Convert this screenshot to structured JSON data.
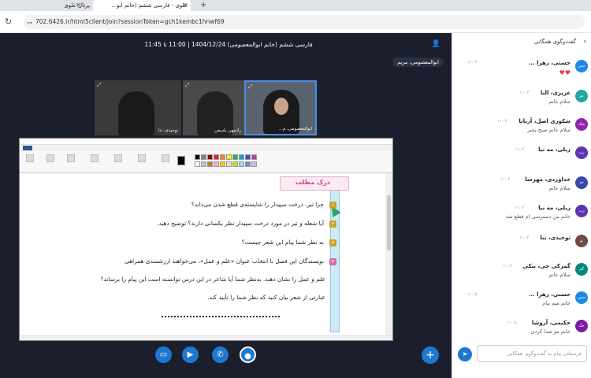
{
  "browser": {
    "tabs": [
      {
        "label": "پرتال علوی"
      },
      {
        "label": "علوی - فارسی ششم (خانم ابو..."
      }
    ],
    "new_tab": "+",
    "url": "702.6426.ir/html5client/join?sessionToken=gch1kembc1hnwf69"
  },
  "meeting": {
    "title": "فارسی ششم (خانم ابوالمعصومی) 1404/12/24 | 11:00 تا 11:45",
    "presenter": "ابوالمعصومی، مریم"
  },
  "videos": [
    {
      "name": "توحیدی، تنا"
    },
    {
      "name": "رادمهر، یاسمن"
    },
    {
      "name": "ابوالمعصومی، م..."
    }
  ],
  "slide": {
    "heading": "درک مطلب",
    "questions": [
      {
        "num": "۱",
        "text": "چرا تبر، درخت سپیدار را شایسته‌ی قطع شدن می‌داند؟"
      },
      {
        "num": "۲",
        "text": "آیا شعله و تیر در مورد درخت سپیدار نظر یکسانی دارند؟ توضیح دهید."
      },
      {
        "num": "۳",
        "text": "به نظر شما پیام این شعر چیست؟"
      },
      {
        "num": "۴",
        "text": "نویسندگان این فصل با انتخاب عنوان «علم و عمل»، می‌خواهند ارزشمندی همراهی"
      },
      {
        "num": "",
        "text": "علم و عمل را نشان دهند. به‌نظر شما آیا شاعر در این درس توانسته است این پیام را برساند؟"
      },
      {
        "num": "",
        "text": "عبارتی از شعر بیان کنید که نظر شما را تأیید کند."
      }
    ]
  },
  "toolbar": {
    "screen_icon": "screen-share-icon",
    "video_icon": "video-icon",
    "phone_icon": "phone-icon",
    "mic_icon": "microphone-icon",
    "add": "+"
  },
  "chat": {
    "title": "گفت‌وگوی همگانی",
    "messages": [
      {
        "avatar": "حس",
        "color": "#1e88e5",
        "author": "حسنی، زهرا ...",
        "time": "۱۱:۰۳",
        "text": "",
        "hearts": "♥♥"
      },
      {
        "avatar": "عز",
        "color": "#26a69a",
        "author": "عزیزی، النا",
        "time": "۱۱:۰۳",
        "text": "سلام خانم",
        "hearts": ""
      },
      {
        "avatar": "شک",
        "color": "#8e24aa",
        "author": "شکوری اصل، آرنانا",
        "time": "۱۱:۰۴",
        "text": "سلام خانم صبح بخیر",
        "hearts": ""
      },
      {
        "avatar": "زب",
        "color": "#5e35b1",
        "author": "زبلی، مه نیا",
        "time": "۱۱:۰۴",
        "text": "",
        "hearts": ""
      },
      {
        "avatar": "خد",
        "color": "#3949ab",
        "author": "خداوردی، مهرسا",
        "time": "۱۱:۰۴",
        "text": "سلام خانم",
        "hearts": ""
      },
      {
        "avatar": "زب",
        "color": "#5e35b1",
        "author": "زبلی، مه نیا",
        "time": "۱۱:۰۴",
        "text": "خانم من دسترسی ام قطع شد",
        "hearts": ""
      },
      {
        "avatar": "تو",
        "color": "#6d4c41",
        "author": "توحیدی، تنا",
        "time": "۱۱:۰۴",
        "text": "",
        "hearts": ""
      },
      {
        "avatar": "گم",
        "color": "#00897b",
        "author": "گمرکی جی، نیکی",
        "time": "۱۱:۰۴",
        "text": "سلام خانم",
        "hearts": ""
      },
      {
        "avatar": "حس",
        "color": "#1e88e5",
        "author": "حسنی، زهرا ...",
        "time": "۱۱:۰۵",
        "text": "خانم میم بیام",
        "hearts": ""
      },
      {
        "avatar": "حک",
        "color": "#7b1fa2",
        "author": "حکیمی، آروشا",
        "time": "۱۱:۰۵",
        "text": "خانم مو صدا کردی",
        "hearts": ""
      }
    ],
    "input_placeholder": "فرستادن پیام به گفت‌وگوی همگانی",
    "send_icon": "send-icon"
  }
}
